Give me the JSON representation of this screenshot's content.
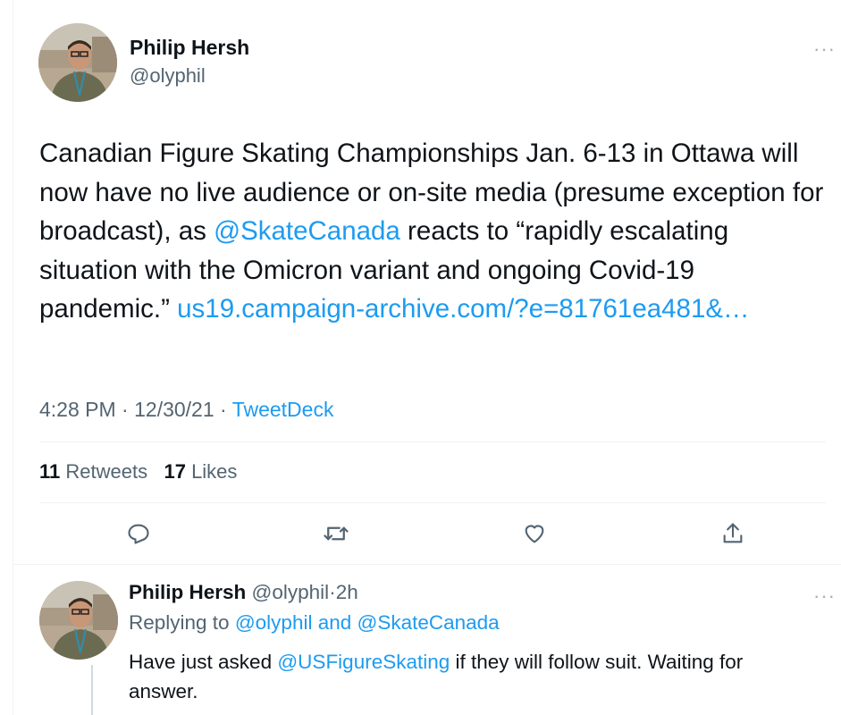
{
  "tweet": {
    "author_name": "Philip Hersh",
    "author_handle": "@olyphil",
    "text_part1": "Canadian Figure Skating Championships Jan. 6-13 in Ottawa will now have no live audience or on-site media (presume exception for broadcast), as ",
    "mention": "@SkateCanada",
    "text_part2": " reacts to “rapidly escalating situation with the Omicron variant and ongoing Covid-19 pandemic.” ",
    "url": "us19.campaign-archive.com/?e=81761ea481&…",
    "time": "4:28 PM",
    "date": "12/30/21",
    "source": "TweetDeck",
    "retweets_count": "11",
    "retweets_label": "Retweets",
    "likes_count": "17",
    "likes_label": "Likes",
    "more_glyph": "···",
    "sep": "·"
  },
  "actions": [
    {
      "name": "reply-icon"
    },
    {
      "name": "retweet-icon"
    },
    {
      "name": "like-icon"
    },
    {
      "name": "share-icon"
    }
  ],
  "reply": {
    "author_name": "Philip Hersh",
    "author_handle": "@olyphil",
    "time_ago": "2h",
    "replying_prefix": "Replying to ",
    "replying_to": "@olyphil and @SkateCanada",
    "text_part1": "Have just asked ",
    "mention": "@USFigureSkating",
    "text_part2": " if they will follow suit.  Waiting for answer."
  },
  "colors": {
    "link": "#1d9bf0",
    "secondary_text": "#536471",
    "primary_text": "#0f1419",
    "divider": "#eff3f4"
  }
}
